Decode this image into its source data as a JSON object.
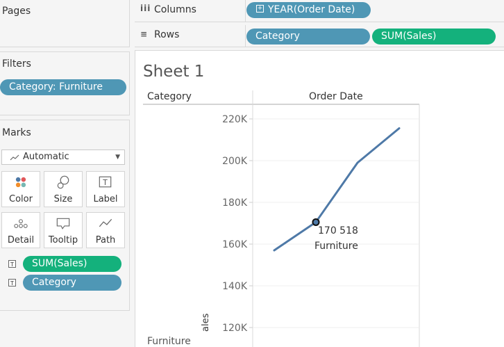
{
  "panels": {
    "pages_title": "Pages",
    "filters_title": "Filters",
    "filters": [
      "Category: Furniture"
    ],
    "marks_title": "Marks",
    "mark_type": "Automatic",
    "mark_buttons": [
      "Color",
      "Size",
      "Label",
      "Detail",
      "Tooltip",
      "Path"
    ],
    "mark_fields": [
      "SUM(Sales)",
      "Category"
    ]
  },
  "shelves": {
    "columns_label": "Columns",
    "rows_label": "Rows",
    "columns_pills": [
      "YEAR(Order Date)"
    ],
    "rows_pills": [
      "Category",
      "SUM(Sales)"
    ]
  },
  "sheet": {
    "title": "Sheet 1",
    "row_header": "Category",
    "col_header": "Order Date",
    "row_value": "Furniture",
    "axis_label_partial": "ales"
  },
  "colors": {
    "dimension_pill": "#4f97b5",
    "measure_pill": "#14b17c",
    "line": "#4e79a7"
  },
  "chart_data": {
    "type": "line",
    "y_ticks": [
      "220K",
      "200K",
      "180K",
      "160K",
      "140K",
      "120K"
    ],
    "ylim": [
      120000,
      220000
    ],
    "values": [
      157000,
      170518,
      199000,
      215500
    ],
    "x": [],
    "highlight": {
      "index": 1,
      "value_label": "170 518",
      "category_label": "Furniture"
    },
    "grid": true
  }
}
